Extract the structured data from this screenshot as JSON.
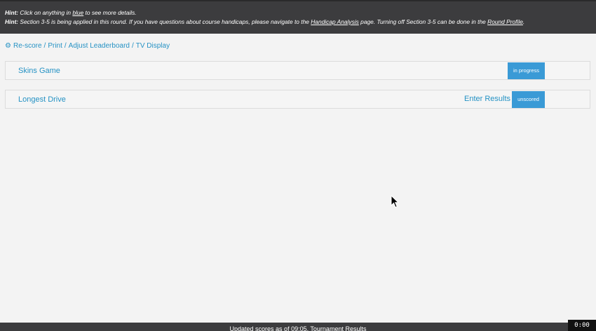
{
  "hints": {
    "line1": {
      "label": "Hint:",
      "before": " Click on anything in ",
      "link": "blue",
      "after": " to see more details."
    },
    "line2": {
      "label": "Hint:",
      "before": " Section 3-5 is being applied in this round. If you have questions about course handicaps, please navigate to the ",
      "link1": "Handicap Analysis",
      "middle": " page. Turning off Section 3-5 can be done in the ",
      "link2": "Round Profile",
      "end": "."
    }
  },
  "actions": {
    "icon": "gear-icon",
    "items": [
      "Re-score",
      "Print",
      "Adjust Leaderboard",
      "TV Display"
    ],
    "separator": " / "
  },
  "games": [
    {
      "name": "Skins Game",
      "status": "in progress"
    },
    {
      "name": "Longest Drive",
      "action": "Enter Results",
      "status": "unscored"
    }
  ],
  "footer": {
    "text": "Updated scores as of 09:05. Tournament Results"
  },
  "timer": {
    "text": "0:00"
  },
  "colors": {
    "link": "#2592c4",
    "badge": "#3a9ad6",
    "bar": "#3c3c3e"
  }
}
